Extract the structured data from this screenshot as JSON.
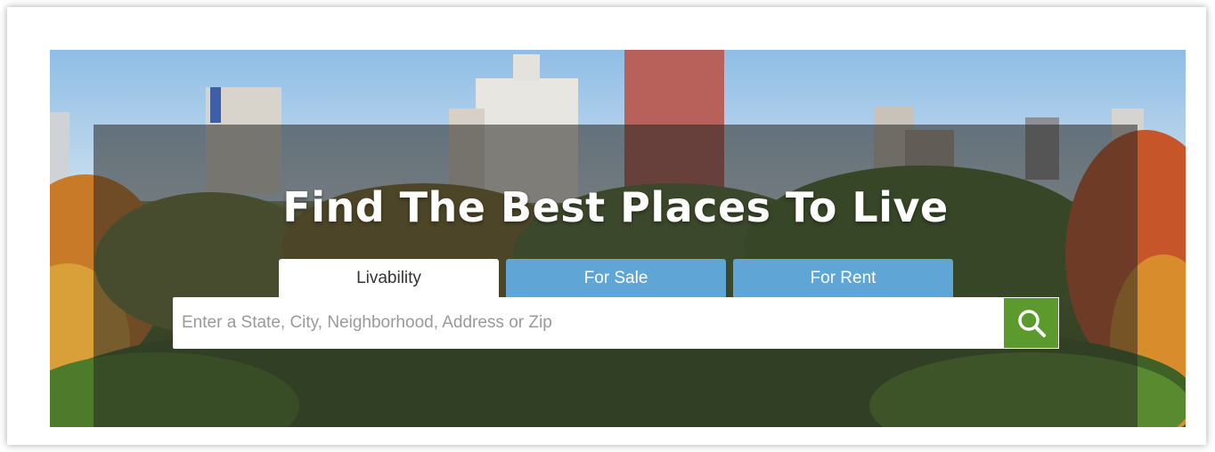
{
  "hero": {
    "headline": "Find The Best Places To Live"
  },
  "tabs": [
    {
      "label": "Livability",
      "active": true
    },
    {
      "label": "For Sale",
      "active": false
    },
    {
      "label": "For Rent",
      "active": false
    }
  ],
  "search": {
    "placeholder": "Enter a State, City, Neighborhood, Address or Zip",
    "value": "",
    "button_icon": "search-icon"
  },
  "colors": {
    "tab_inactive": "#5fa6d6",
    "search_button": "#5c9a2e",
    "headline": "#ffffff"
  }
}
